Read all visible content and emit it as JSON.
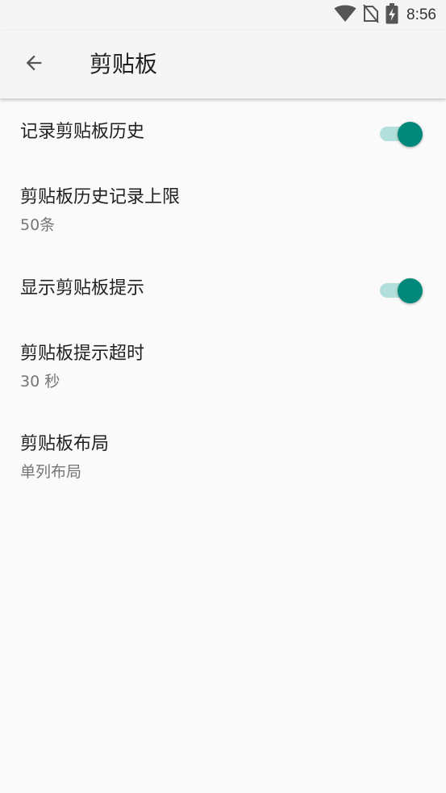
{
  "status_bar": {
    "time": "8:56",
    "icons": [
      "wifi-icon",
      "no-sim-icon",
      "battery-charging-icon"
    ]
  },
  "app_bar": {
    "back_icon": "arrow-back-icon",
    "title": "剪贴板"
  },
  "settings": {
    "record_history": {
      "title": "记录剪贴板历史",
      "enabled": true
    },
    "history_limit": {
      "title": "剪贴板历史记录上限",
      "summary": "50条"
    },
    "show_hint": {
      "title": "显示剪贴板提示",
      "enabled": true
    },
    "hint_timeout": {
      "title": "剪贴板提示超时",
      "summary": "30 秒"
    },
    "layout": {
      "title": "剪贴板布局",
      "summary": "单列布局"
    }
  },
  "colors": {
    "accent": "#00897b",
    "track": "#b2dfdb",
    "background": "#fafafa",
    "bar": "#f5f5f5"
  }
}
